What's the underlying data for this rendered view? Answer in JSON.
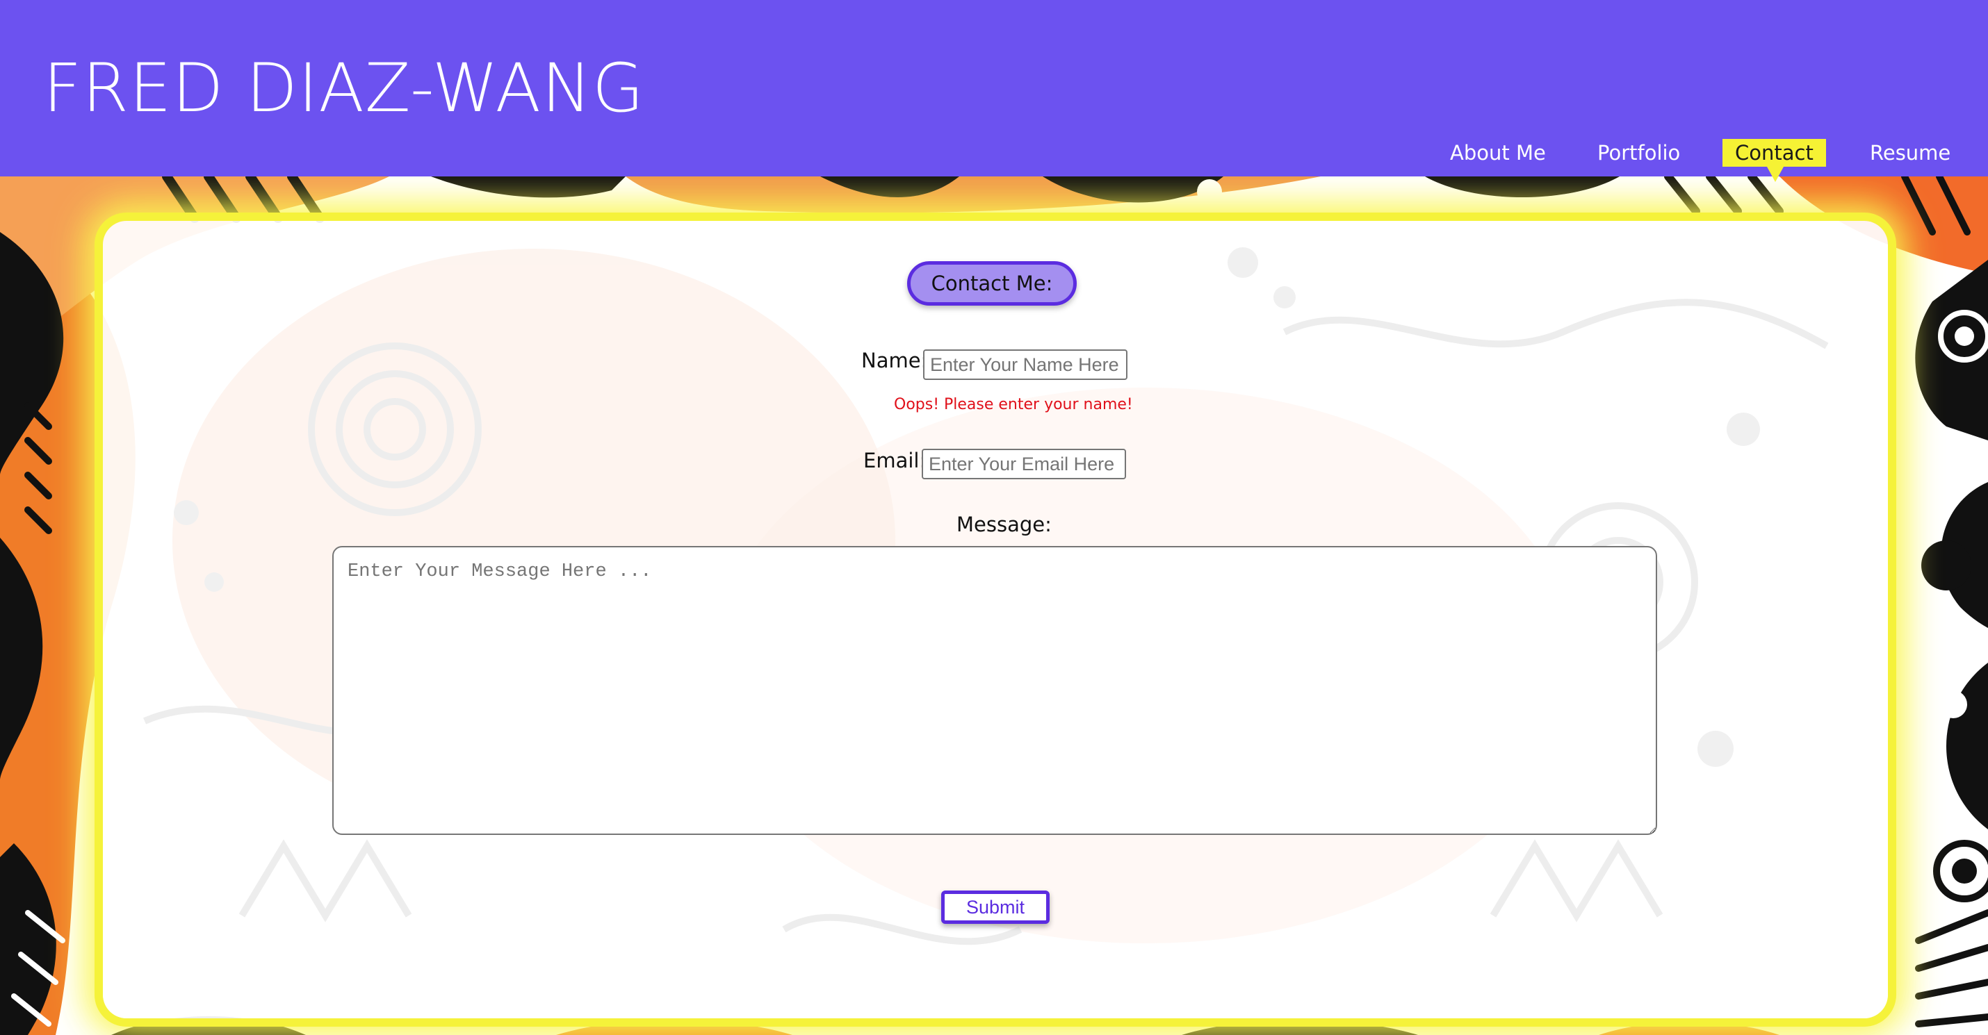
{
  "header": {
    "title": "FRED DIAZ-WANG",
    "background_color": "#6c52f0"
  },
  "nav": {
    "items": [
      {
        "label": "About Me",
        "active": false
      },
      {
        "label": "Portfolio",
        "active": false
      },
      {
        "label": "Contact",
        "active": true
      },
      {
        "label": "Resume",
        "active": false
      }
    ],
    "active_color": "#f6f234"
  },
  "contact_form": {
    "heading": "Contact Me:",
    "name_label": "Name:",
    "name_placeholder": "Enter Your Name Here",
    "name_value": "",
    "name_error": "Oops! Please enter your name!",
    "email_label": "Email:",
    "email_placeholder": "Enter Your Email Here ...",
    "email_value": "",
    "message_label": "Message:",
    "message_placeholder": "Enter Your Message Here ...",
    "message_value": "",
    "submit_label": "Submit"
  },
  "colors": {
    "accent": "#5b2ce0",
    "card_glow": "#f5f23a",
    "error": "#e0101a"
  }
}
